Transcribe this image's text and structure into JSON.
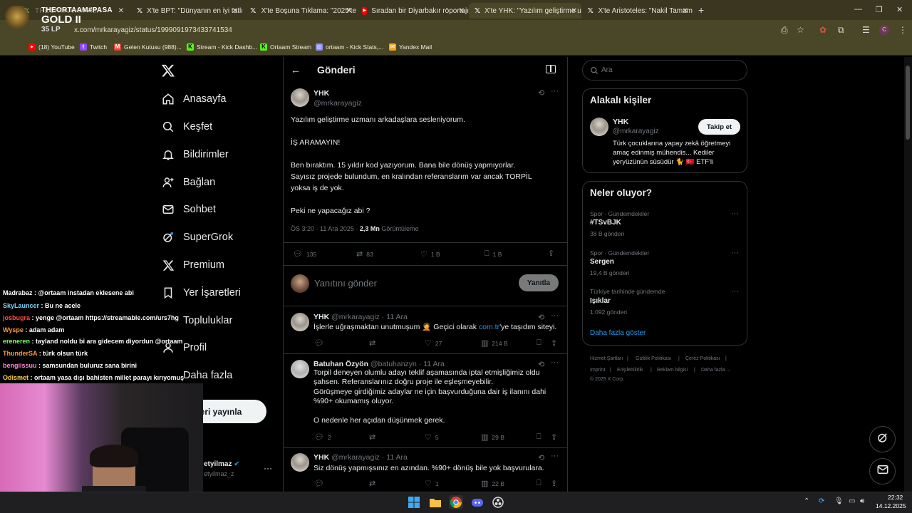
{
  "browser": {
    "tabs": [
      {
        "label": "THEORTAAM#PASA",
        "icon": "x"
      },
      {
        "label": "X'te BPT: \"Dünyanın en iyi tatlı",
        "icon": "x"
      },
      {
        "label": "X'te Boşuna Tıklama: \"2025'te",
        "icon": "x"
      },
      {
        "label": "Sıradan bir Diyarbakır röportajı",
        "icon": "youtube"
      },
      {
        "label": "X'te YHK: \"Yazılım geliştirme uz",
        "icon": "x"
      },
      {
        "label": "X'te Aristoteles: \"Nakil Tamam",
        "icon": "x"
      }
    ],
    "url": "x.com/mrkarayagiz/status/1999091973433741534",
    "bookmarks": [
      {
        "label": "(18) YouTube",
        "color": "#ff0000"
      },
      {
        "label": "Twitch",
        "color": "#9146ff"
      },
      {
        "label": "Gelen Kutusu (988)...",
        "color": "#ea4335"
      },
      {
        "label": "Stream - Kick Dashb...",
        "color": "#53fc18"
      },
      {
        "label": "Ortaam Stream",
        "color": "#53fc18"
      },
      {
        "label": "ortaam - Kick Stats,...",
        "color": "#8a8aff"
      },
      {
        "label": "Yandex Mail",
        "color": "#f4a623"
      }
    ]
  },
  "overlay": {
    "rank_name": "THEORTAAM#PASA",
    "rank_title": "GOLD II",
    "rank_lp": "35 LP"
  },
  "nav": {
    "items": [
      {
        "label": "Anasayfa",
        "icon": "home-icon"
      },
      {
        "label": "Keşfet",
        "icon": "search-icon"
      },
      {
        "label": "Bildirimler",
        "icon": "bell-icon"
      },
      {
        "label": "Bağlan",
        "icon": "add-person-icon"
      },
      {
        "label": "Sohbet",
        "icon": "mail-icon"
      },
      {
        "label": "SuperGrok",
        "icon": "grok-icon"
      },
      {
        "label": "Premium",
        "icon": "x-icon"
      },
      {
        "label": "Yer İşaretleri",
        "icon": "bookmark-icon"
      },
      {
        "label": "Topluluklar",
        "icon": "people-icon"
      },
      {
        "label": "Profil",
        "icon": "person-icon"
      },
      {
        "label": "Daha fazla",
        "icon": "more-circle-icon"
      }
    ],
    "post_button": "eri yayınla",
    "account_name": "etyilmaz",
    "account_handle": "etyilmaz_z"
  },
  "header": {
    "title": "Gönderi"
  },
  "tweet": {
    "author": "YHK",
    "handle": "@mrkarayagiz",
    "lines": [
      "Yazılım geliştirme uzmanı arkadaşlara sesleniyorum.",
      "İŞ ARAMAYIN!",
      "Ben bıraktım. 15 yıldır kod yazıyorum. Bana bile dönüş yapmıyorlar.",
      "Sayısız projede bulundum, en kralından referanslarım var ancak TORPİL",
      "yoksa iş de yok.",
      "Peki ne yapacağız abi ?"
    ],
    "time": "ÖS 3:20 · 11 Ara 2025 · ",
    "views": "2,3 Mn",
    "views_label": "Görüntüleme",
    "replies": "135",
    "reposts": "83",
    "likes": "1 B",
    "bookmarks": "1 B"
  },
  "reply_box": {
    "placeholder": "Yanıtını gönder",
    "button": "Yanıtla"
  },
  "replies": [
    {
      "author": "YHK",
      "handle": "@mrkarayagiz · 11 Ara",
      "text_before": "İşlerle uğraşmaktan unutmuşum 🤦 Geçici olarak ",
      "link": "com.tr",
      "text_after": "'ye taşıdım siteyi.",
      "likes": "27",
      "views": "214 B"
    },
    {
      "author": "Batuhan Özyön",
      "handle": "@batuhanzyn · 11 Ara",
      "lines": [
        "Torpil deneyen olumlu adayı teklif aşamasında iptal etmişliğimiz oldu",
        "şahsen. Referanslarınız doğru proje ile eşleşmeyebilir.",
        "Görüşmeye girdiğimiz adaylar ne için başvurduğuna dair iş ilanını dahi",
        "%90+ okumamış oluyor.",
        "O nedenle her açıdan düşünmek gerek."
      ],
      "replies": "2",
      "likes": "5",
      "views": "29 B"
    },
    {
      "author": "YHK",
      "handle": "@mrkarayagiz · 11 Ara",
      "text": "Siz dönüş yapmışsınız en azından. %90+ dönüş bile yok başvurulara.",
      "likes": "1",
      "views": "22 B"
    }
  ],
  "right": {
    "search_placeholder": "Ara",
    "people_title": "Alakalı kişiler",
    "person_name": "YHK",
    "person_handle": "@mrkarayagiz",
    "person_bio_1": "Türk çocuklarına yapay zekâ öğretmeyi",
    "person_bio_2": "amaç edinmiş mühendis... Kediler",
    "person_bio_3": "yeryüzünün süsüdür 🐈 🇹🇷 ETF'li",
    "follow_button": "Takip et",
    "trends_title": "Neler oluyor?",
    "trends": [
      {
        "category": "Spor · Gündemdekiler",
        "name": "#TSvBJK",
        "count": "38 B gönderi"
      },
      {
        "category": "Spor · Gündemdekiler",
        "name": "Sergen",
        "count": "19,4 B gönderi"
      },
      {
        "category": "Türkiye tarihinde gündemde",
        "name": "Işıklar",
        "count": "1.092 gönderi"
      }
    ],
    "show_more": "Daha fazla göster",
    "footer_1": [
      "Hizmet Şartları",
      "Gizlilik Politikası",
      "Çerez Politikası"
    ],
    "footer_2": [
      "Imprint",
      "Erişilebilirlik",
      "Reklam bilgisi",
      "Daha fazla ..."
    ],
    "copyright": "© 2025 X Corp."
  },
  "chat": [
    {
      "user": "Madrabaz",
      "color": "#ffffff",
      "text": ": @ortaam instadan eklesene abi"
    },
    {
      "user": "SkyLauncer",
      "color": "#7ad7ff",
      "text": ": Bu ne acele"
    },
    {
      "user": "josbugra",
      "color": "#ff4d4d",
      "text": ": yenge @ortaam https://streamable.com/urs7hg"
    },
    {
      "user": "Wyspe",
      "color": "#ff9a3c",
      "text": ": adam adam"
    },
    {
      "user": "ereneren",
      "color": "#7cff6b",
      "text": ": tayland noldu bi ara gidecem diyordun @ortaam"
    },
    {
      "user": "ThunderSA",
      "color": "#ff9a3c",
      "text": ": türk olsun türk"
    },
    {
      "user": "bengiissuu",
      "color": "#ff8ad8",
      "text": ": samsundan buluruz sana birini"
    },
    {
      "user": "Odismet",
      "color": "#ffd23c",
      "text": ": ortaam yasa dışı bahisten millet parayı kırıyomuş"
    }
  ],
  "taskbar": {
    "time": "22:32",
    "date": "14.12.2025"
  }
}
